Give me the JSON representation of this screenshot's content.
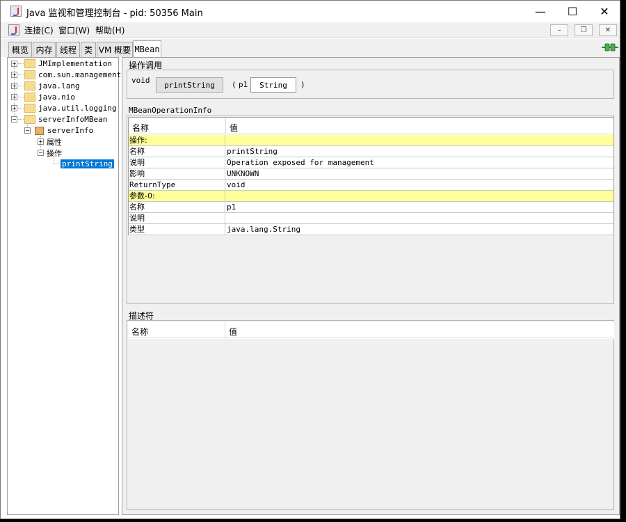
{
  "window": {
    "title": "Java 监视和管理控制台 - pid: 50356 Main",
    "minimize_glyph": "—",
    "maximize_glyph": "☐",
    "close_glyph": "✕"
  },
  "menu": {
    "items": [
      "连接(C)",
      "窗口(W)",
      "帮助(H)"
    ],
    "mdi_minimize": "–",
    "mdi_restore": "❐",
    "mdi_close": "✕"
  },
  "tabs": [
    {
      "label": "概览",
      "active": false
    },
    {
      "label": "内存",
      "active": false
    },
    {
      "label": "线程",
      "active": false
    },
    {
      "label": "类",
      "active": false
    },
    {
      "label": "VM 概要",
      "active": false
    },
    {
      "label": "MBean",
      "active": true
    }
  ],
  "tree": {
    "nodes": [
      {
        "label": "JMImplementation",
        "expander": "+"
      },
      {
        "label": "com.sun.management",
        "expander": "+"
      },
      {
        "label": "java.lang",
        "expander": "+"
      },
      {
        "label": "java.nio",
        "expander": "+"
      },
      {
        "label": "java.util.logging",
        "expander": "+"
      },
      {
        "label": "serverInfoMBean",
        "expander": "−"
      }
    ],
    "bean_label": "serverInfo",
    "bean_expander": "−",
    "attributes_label": "属性",
    "attributes_expander": "+",
    "operations_label": "操作",
    "operations_expander": "−",
    "selected_operation": "printString"
  },
  "operation_invoke": {
    "title": "操作调用",
    "return_type": "void",
    "button_label": "printString",
    "open_paren": "(",
    "param_name": "p1",
    "param_value": "String",
    "close_paren": ")"
  },
  "operation_info": {
    "title": "MBeanOperationInfo",
    "header": {
      "name": "名称",
      "value": "值"
    },
    "rows": [
      {
        "name": "操作:",
        "value": "",
        "highlight": true
      },
      {
        "name": "名称",
        "value": "printString",
        "highlight": false
      },
      {
        "name": "说明",
        "value": "Operation exposed for management",
        "highlight": false
      },
      {
        "name": "影响",
        "value": "UNKNOWN",
        "highlight": false
      },
      {
        "name": "ReturnType",
        "value": "void",
        "highlight": false
      },
      {
        "name": "参数-0:",
        "value": "",
        "highlight": true
      },
      {
        "name": "名称",
        "value": "p1",
        "highlight": false
      },
      {
        "name": "说明",
        "value": "",
        "highlight": false
      },
      {
        "name": "类型",
        "value": "java.lang.String",
        "highlight": false
      }
    ]
  },
  "descriptor": {
    "title": "描述符",
    "header": {
      "name": "名称",
      "value": "值"
    }
  },
  "colors": {
    "highlight_row": "#ffff99",
    "selection": "#0078d7"
  }
}
